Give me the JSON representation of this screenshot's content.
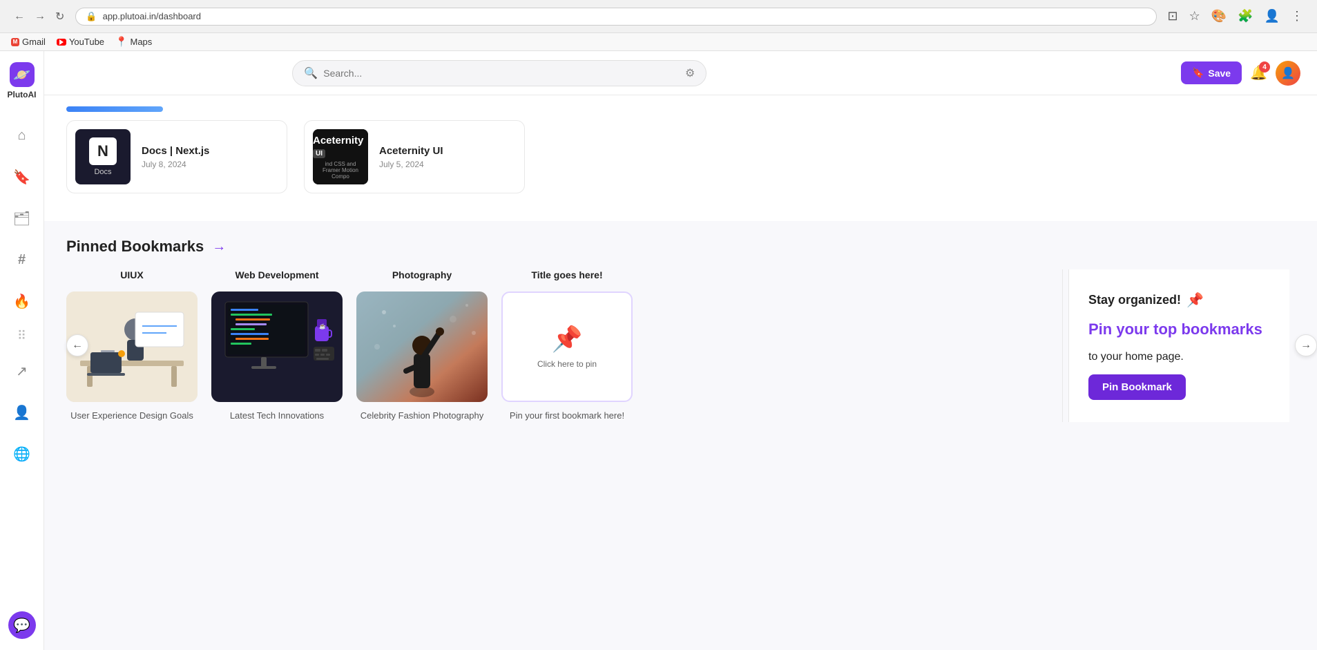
{
  "browser": {
    "url": "app.plutoai.in/dashboard",
    "bookmarks": [
      {
        "id": "gmail",
        "label": "Gmail",
        "icon": "gmail"
      },
      {
        "id": "youtube",
        "label": "YouTube",
        "icon": "youtube"
      },
      {
        "id": "maps",
        "label": "Maps",
        "icon": "maps"
      }
    ]
  },
  "header": {
    "logo_icon": "🪐",
    "logo_label": "PlutoAI",
    "search_placeholder": "Search...",
    "save_label": "Save",
    "notification_count": "4"
  },
  "recent_bookmarks": [
    {
      "id": "docs-nextjs",
      "title": "Docs | Next.js",
      "date": "July 8, 2024",
      "thumb_type": "docs"
    },
    {
      "id": "aceternity-ui",
      "title": "Aceternity UI",
      "date": "July 5, 2024",
      "thumb_type": "aceternity"
    }
  ],
  "pinned_section": {
    "title": "Pinned Bookmarks",
    "arrow": "→",
    "cards": [
      {
        "id": "uiux",
        "label": "UIUX",
        "caption": "User Experience Design Goals",
        "image_type": "uiux"
      },
      {
        "id": "web-development",
        "label": "Web Development",
        "caption": "Latest Tech Innovations",
        "image_type": "webdev"
      },
      {
        "id": "photography",
        "label": "Photography",
        "caption": "Celebrity Fashion Photography",
        "image_type": "photo"
      },
      {
        "id": "empty",
        "label": "Title goes here!",
        "caption": "Pin your first bookmark here!",
        "image_type": "empty",
        "click_text": "Click here to pin"
      }
    ],
    "stay_organized": {
      "title": "Stay organized!",
      "highlight": "Pin your top bookmarks",
      "subtitle": "to your home page.",
      "button_label": "Pin Bookmark"
    }
  },
  "sidebar": {
    "items": [
      {
        "id": "home",
        "icon": "🏠",
        "label": "home"
      },
      {
        "id": "bookmark",
        "icon": "🔖",
        "label": "bookmark"
      },
      {
        "id": "folder",
        "icon": "📁",
        "label": "folder"
      },
      {
        "id": "tag",
        "icon": "#",
        "label": "tag"
      },
      {
        "id": "trend",
        "icon": "🔥",
        "label": "trend"
      },
      {
        "id": "share",
        "icon": "↗",
        "label": "share"
      },
      {
        "id": "people",
        "icon": "👤",
        "label": "people"
      },
      {
        "id": "globe",
        "icon": "🌐",
        "label": "globe"
      }
    ]
  }
}
